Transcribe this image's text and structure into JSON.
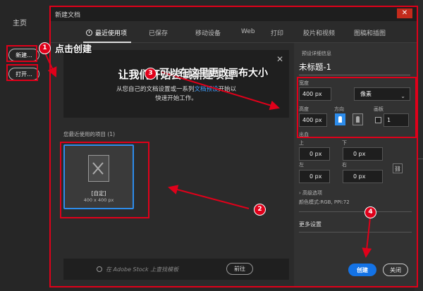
{
  "home": {
    "title": "主页",
    "new_button": "新建...",
    "open_button": "打开..."
  },
  "dialog": {
    "title": "新建文档",
    "close_glyph": "✕",
    "tabs": [
      {
        "label": "最近使用项",
        "active": true
      },
      {
        "label": "已保存"
      },
      {
        "label": "移动设备"
      },
      {
        "label": "Web"
      },
      {
        "label": "打印"
      },
      {
        "label": "胶片和视频"
      },
      {
        "label": "图稿和插图"
      }
    ],
    "welcome": {
      "close_glyph": "✕",
      "heading": "让我们开始尝试新建项目",
      "line1_before": "从您自己的文档设置或一系列",
      "line1_link": "文档预设",
      "line1_after": "开始以",
      "line2": "快速开始工作。"
    },
    "recent_label": "您最近使用的项目 (1)",
    "recent_items": [
      {
        "name": "[自定]",
        "size": "400 x 400 px"
      }
    ],
    "search": {
      "placeholder": "在 Adobe Stock 上查找模板",
      "button": "前往"
    },
    "preset": {
      "header": "预设详细信息",
      "name": "未标题-1",
      "width_label": "宽度",
      "width_value": "400 px",
      "unit": "像素",
      "height_label": "高度",
      "height_value": "400 px",
      "orientation_label": "方向",
      "artboard_label": "画板",
      "artboard_count": "1",
      "bleed_label": "出血",
      "top_label": "上",
      "top_value": "0 px",
      "bottom_label": "下",
      "bottom_value": "0 px",
      "left_label": "左",
      "left_value": "0 px",
      "right_label": "右",
      "right_value": "0 px",
      "advanced_label": "高级选项",
      "color_mode": "颜色模式:RGB, PPI:72",
      "more_settings": "更多设置"
    },
    "create_button": "创建",
    "close_button": "关闭"
  },
  "annotations": {
    "step1_num": "1",
    "step1_text": "点击创建",
    "step2_num": "2",
    "step3_num": "3",
    "step3_text": "可以在这里更改画布大小",
    "step4_num": "4"
  },
  "colors": {
    "accent": "#1473e6",
    "annotation": "#e0001a",
    "selection": "#2d8ceb"
  }
}
